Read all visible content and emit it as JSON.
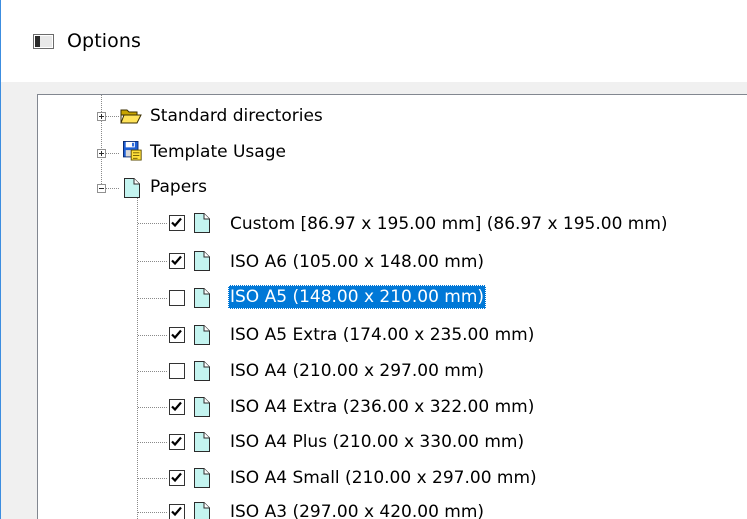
{
  "window": {
    "title": "Options",
    "accent_color": "#3c8de0",
    "selection_color": "#0078d7"
  },
  "tree": {
    "top_nodes": [
      {
        "label": "Standard directories",
        "icon": "folder-open-icon",
        "expanded": false
      },
      {
        "label": "Template Usage",
        "icon": "save-template-icon",
        "expanded": false
      },
      {
        "label": "Papers",
        "icon": "document-icon",
        "expanded": true
      }
    ],
    "papers": [
      {
        "label": "Custom [86.97 x 195.00 mm] (86.97 x 195.00 mm)",
        "checked": true,
        "selected": false
      },
      {
        "label": "ISO A6 (105.00 x 148.00 mm)",
        "checked": true,
        "selected": false
      },
      {
        "label": "ISO A5 (148.00 x 210.00 mm)",
        "checked": false,
        "selected": true
      },
      {
        "label": "ISO A5 Extra (174.00 x 235.00 mm)",
        "checked": true,
        "selected": false
      },
      {
        "label": "ISO A4 (210.00 x 297.00 mm)",
        "checked": false,
        "selected": false
      },
      {
        "label": "ISO A4 Extra (236.00 x 322.00 mm)",
        "checked": true,
        "selected": false
      },
      {
        "label": "ISO A4 Plus (210.00 x 330.00 mm)",
        "checked": true,
        "selected": false
      },
      {
        "label": "ISO A4 Small (210.00 x 297.00 mm)",
        "checked": true,
        "selected": false
      },
      {
        "label": "ISO A3 (297.00 x 420.00 mm)",
        "checked": true,
        "selected": false
      }
    ]
  }
}
